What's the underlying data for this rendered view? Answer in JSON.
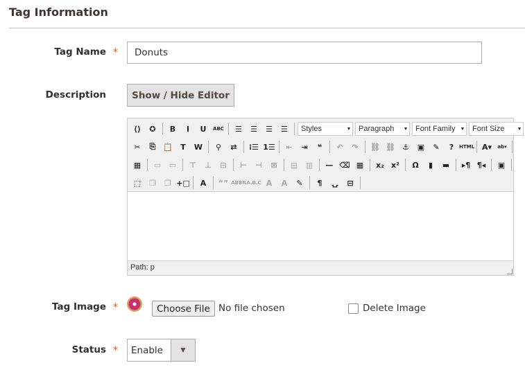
{
  "section_title": "Tag Information",
  "fields": {
    "tag_name": {
      "label": "Tag Name",
      "required_mark": "*",
      "value": "Donuts"
    },
    "description": {
      "label": "Description",
      "toggle_button": "Show / Hide Editor"
    },
    "tag_image": {
      "label": "Tag Image",
      "required_mark": "*",
      "choose_file": "Choose File",
      "no_file": "No file chosen",
      "delete_label": "Delete Image",
      "delete_checked": false
    },
    "status": {
      "label": "Status",
      "required_mark": "*",
      "value": "Enable"
    }
  },
  "editor": {
    "path": "Path: p",
    "selects": [
      {
        "label": "Styles",
        "w": 80
      },
      {
        "label": "Paragraph",
        "w": 79
      },
      {
        "label": "Font Family",
        "w": 79
      },
      {
        "label": "Font Size",
        "w": 79
      }
    ],
    "rows": [
      [
        [
          [
            "widget",
            "⟨⟩",
            0
          ],
          [
            "variable",
            "✪",
            0
          ]
        ],
        [
          [
            "bold",
            "B",
            0
          ],
          [
            "italic",
            "I",
            0
          ],
          [
            "underline",
            "U",
            0
          ],
          [
            "strikethrough",
            "ABC",
            0
          ]
        ],
        [
          [
            "align-left",
            "☰",
            0
          ],
          [
            "align-center",
            "☰",
            0
          ],
          [
            "align-right",
            "☰",
            0
          ],
          [
            "align-justify",
            "☰",
            0
          ]
        ]
      ],
      [
        [
          [
            "cut",
            "✂",
            0
          ],
          [
            "copy",
            "⎘",
            0
          ],
          [
            "paste",
            "📋",
            0
          ],
          [
            "paste-text",
            "T",
            0
          ],
          [
            "paste-word",
            "W",
            0
          ]
        ],
        [
          [
            "search",
            "⚲",
            0
          ],
          [
            "replace",
            "⇄",
            0
          ]
        ],
        [
          [
            "bullet-list",
            "⁝☰",
            0
          ],
          [
            "numbered-list",
            "1☰",
            0
          ]
        ],
        [
          [
            "outdent",
            "⇤",
            1
          ],
          [
            "indent",
            "⇥",
            0
          ],
          [
            "blockquote",
            "❝",
            0
          ]
        ],
        [
          [
            "undo",
            "↶",
            1
          ],
          [
            "redo",
            "↷",
            1
          ]
        ],
        [
          [
            "link",
            "⛓",
            1
          ],
          [
            "unlink",
            "⛓",
            1
          ],
          [
            "anchor",
            "⚓",
            0
          ],
          [
            "image",
            "▣",
            0
          ],
          [
            "cleanup",
            "✎",
            0
          ],
          [
            "help",
            "?",
            0
          ],
          [
            "html",
            "HTML",
            0
          ]
        ],
        [
          [
            "text-color",
            "A▾",
            0
          ],
          [
            "background-color",
            "ab▾",
            0
          ]
        ]
      ],
      [
        [
          [
            "table-properties",
            "▦",
            0
          ]
        ],
        [
          [
            "row-properties",
            "▭",
            1
          ],
          [
            "cell-properties",
            "▭",
            1
          ]
        ],
        [
          [
            "insert-row-before",
            "⊤",
            1
          ],
          [
            "insert-row-after",
            "⊥",
            1
          ],
          [
            "delete-row",
            "⊟",
            1
          ]
        ],
        [
          [
            "insert-col-before",
            "⊢",
            1
          ],
          [
            "insert-col-after",
            "⊣",
            1
          ],
          [
            "delete-col",
            "⊠",
            1
          ]
        ],
        [
          [
            "split-cells",
            "▤",
            1
          ],
          [
            "merge-cells",
            "▥",
            1
          ]
        ],
        [
          [
            "horizontal-rule",
            "—",
            0
          ],
          [
            "remove-format",
            "⌫",
            0
          ],
          [
            "visual-aid",
            "▦",
            0
          ]
        ],
        [
          [
            "subscript",
            "x₂",
            0
          ],
          [
            "superscript",
            "x²",
            0
          ]
        ],
        [
          [
            "special-char",
            "Ω",
            0
          ],
          [
            "media",
            "▮",
            0
          ],
          [
            "advanced-hr",
            "▬",
            0
          ]
        ],
        [
          [
            "ltr",
            "▸¶",
            0
          ],
          [
            "rtl",
            "¶◂",
            0
          ]
        ],
        [
          [
            "fullscreen",
            "▣",
            0
          ]
        ]
      ],
      [
        [
          [
            "insert-layer",
            "⬚",
            0
          ],
          [
            "move-forward",
            "❐",
            1
          ],
          [
            "move-backward",
            "❐",
            1
          ],
          [
            "absolute",
            "+□",
            0
          ]
        ],
        [
          [
            "style-props",
            "A",
            0
          ]
        ],
        [
          [
            "cite",
            "“”",
            1
          ],
          [
            "abbr",
            "ABBR",
            1
          ],
          [
            "acronym",
            "A.B.C",
            1
          ],
          [
            "del",
            "A",
            1
          ],
          [
            "ins",
            "A",
            1
          ],
          [
            "attributes",
            "✎",
            0
          ]
        ],
        [
          [
            "visual-chars",
            "¶",
            0
          ],
          [
            "nonbreaking",
            "⍽",
            0
          ],
          [
            "page-break",
            "⊟",
            0
          ]
        ]
      ]
    ]
  }
}
